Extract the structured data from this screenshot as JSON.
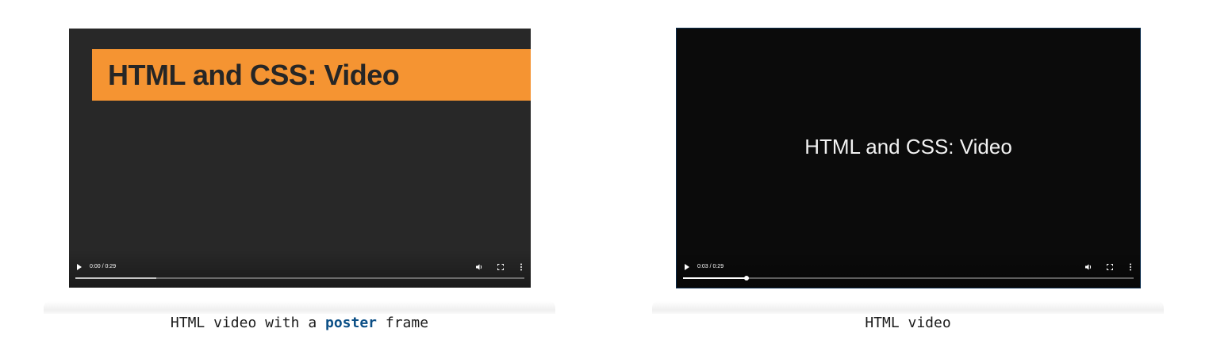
{
  "examples": [
    {
      "poster_title": "HTML and CSS: Video",
      "time": "0:00 / 0:29",
      "progress": 0,
      "buffered": 0.18,
      "caption_before": "HTML video with a ",
      "caption_code": "poster",
      "caption_after": " frame"
    },
    {
      "video_text": "HTML and CSS: Video",
      "time": "0:03 / 0:29",
      "progress": 0.14,
      "caption": "HTML video"
    }
  ],
  "icons": {
    "play": "play-icon",
    "volume": "volume-icon",
    "fullscreen": "fullscreen-icon",
    "more": "more-options-icon"
  },
  "colors": {
    "poster_band": "#f59432",
    "poster_bg": "#282828",
    "video_bg": "#0b0b0b",
    "caption_code": "#0b4f86"
  }
}
